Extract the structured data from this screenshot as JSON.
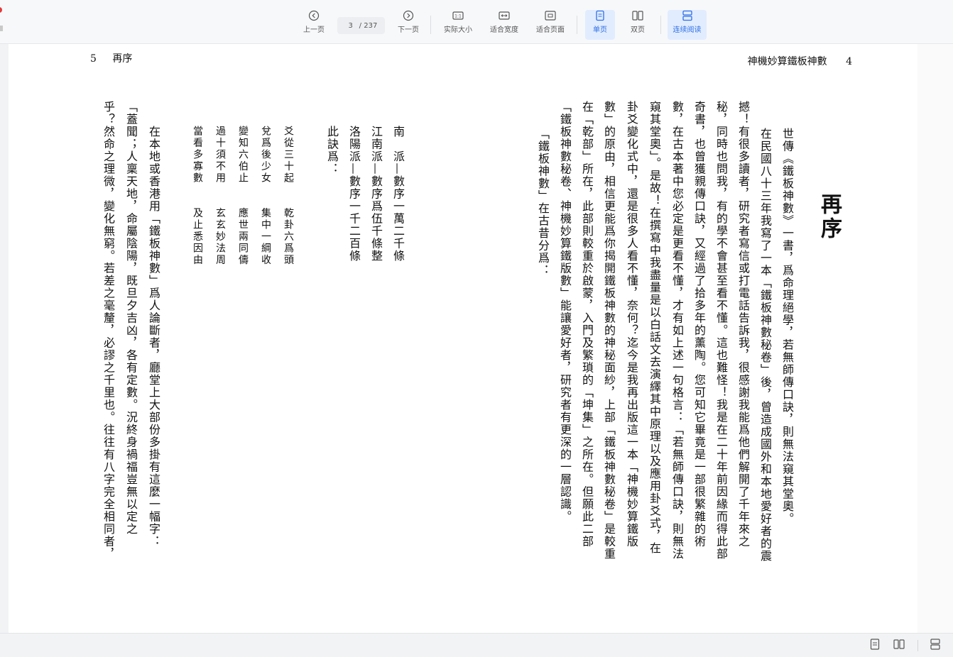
{
  "toolbar": {
    "prev_label": "上一页",
    "page_current": "3",
    "page_total": "/ 237",
    "next_label": "下一页",
    "actual_size_label": "实际大小",
    "fit_width_label": "适合宽度",
    "fit_page_label": "适合页面",
    "single_label": "单页",
    "double_label": "双页",
    "continuous_label": "连续阅读",
    "active_color": "#2f6fe4"
  },
  "page": {
    "left_header_num": "5",
    "left_header_title": "再序",
    "right_header_title": "神機妙算鐵板神數",
    "right_header_num": "4",
    "title": "再序",
    "right_columns": [
      "世傳《鐵板神數》一書，爲命理絕學，若無師傳口訣，則無法窺其堂奧。",
      "在民國八十三年我寫了一本「鐵板神數秘卷」後，曾造成國外和本地愛好者的震",
      "撼！有很多讀者，研究者寫信或打電話告訴我，很感謝我能爲他們解開了千年來之",
      "秘，同時也問我，有的學不會甚至看不懂。這也難怪！我是在二十年前因緣而得此部",
      "奇書，也曾獲親傳口訣，又經過了拾多年的薰陶。您可知它畢竟是一部很繁雜的術",
      "數，在古本著中您必定是更看不懂，才有如上述一句格言：「若無師傳口訣，則無法",
      "窺其堂奧」。是故！在撰寫中我盡量是以白話文去演繹其中原理以及應用卦爻式，在",
      "卦爻變化式中，還是很多人看不懂，奈何？迄今是我再出版這一本「神機妙算鐵版",
      "數」的原由，相信更能爲你揭開鐵板神數的神秘面紗，上部「鐵板神數秘卷」是較重",
      "在「乾部」所在，此部則較重於啟蒙，入門及繁瑣的「坤集」之所在。但願此二部",
      "「鐵板神數秘卷、神機妙算鐵版數」能讓愛好者，研究者有更深的一層認識。",
      "「鐵板神數」在古昔分爲："
    ],
    "left_columns": [
      "南　派—數序一萬二千條",
      "江南派—數序爲伍千條整",
      "洛陽派—數序一千二百條",
      "此訣爲："
    ],
    "verse_columns": [
      "爻從三十起　　乾卦六爲頭",
      "兌爲後少女　　集中一綱收",
      "變知六伯止　　應世兩同儔",
      "過十須不用　　玄玄妙法周",
      "當看多寡數　　及止悉因由"
    ],
    "tail_columns": [
      "在本地或香港用「鐵板神數」爲人論斷者，廳堂上大部份多掛有這麼一幅字：",
      "「蓋聞；人稟天地，命屬陰陽，既旦夕吉凶，各有定數。況終身禍福豈無以定之",
      "乎？然命之理微，變化無窮。若差之毫釐，必謬之千里也。往往有八字完全相同者，"
    ]
  }
}
